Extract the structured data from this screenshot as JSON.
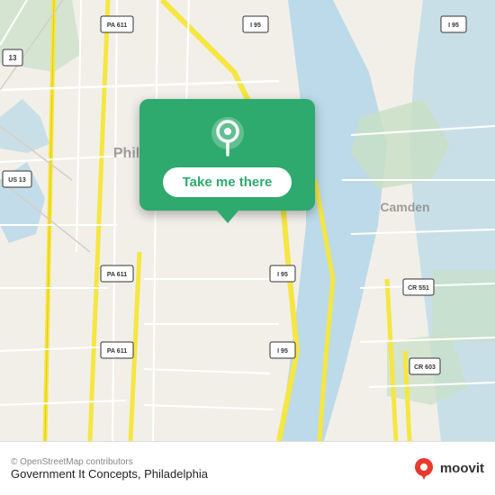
{
  "map": {
    "alt": "Map of Philadelphia area"
  },
  "popup": {
    "button_label": "Take me there",
    "icon_name": "location-pin-icon"
  },
  "bottom_bar": {
    "copyright": "© OpenStreetMap contributors",
    "location_name": "Government It Concepts, Philadelphia",
    "logo_text": "moovit"
  }
}
